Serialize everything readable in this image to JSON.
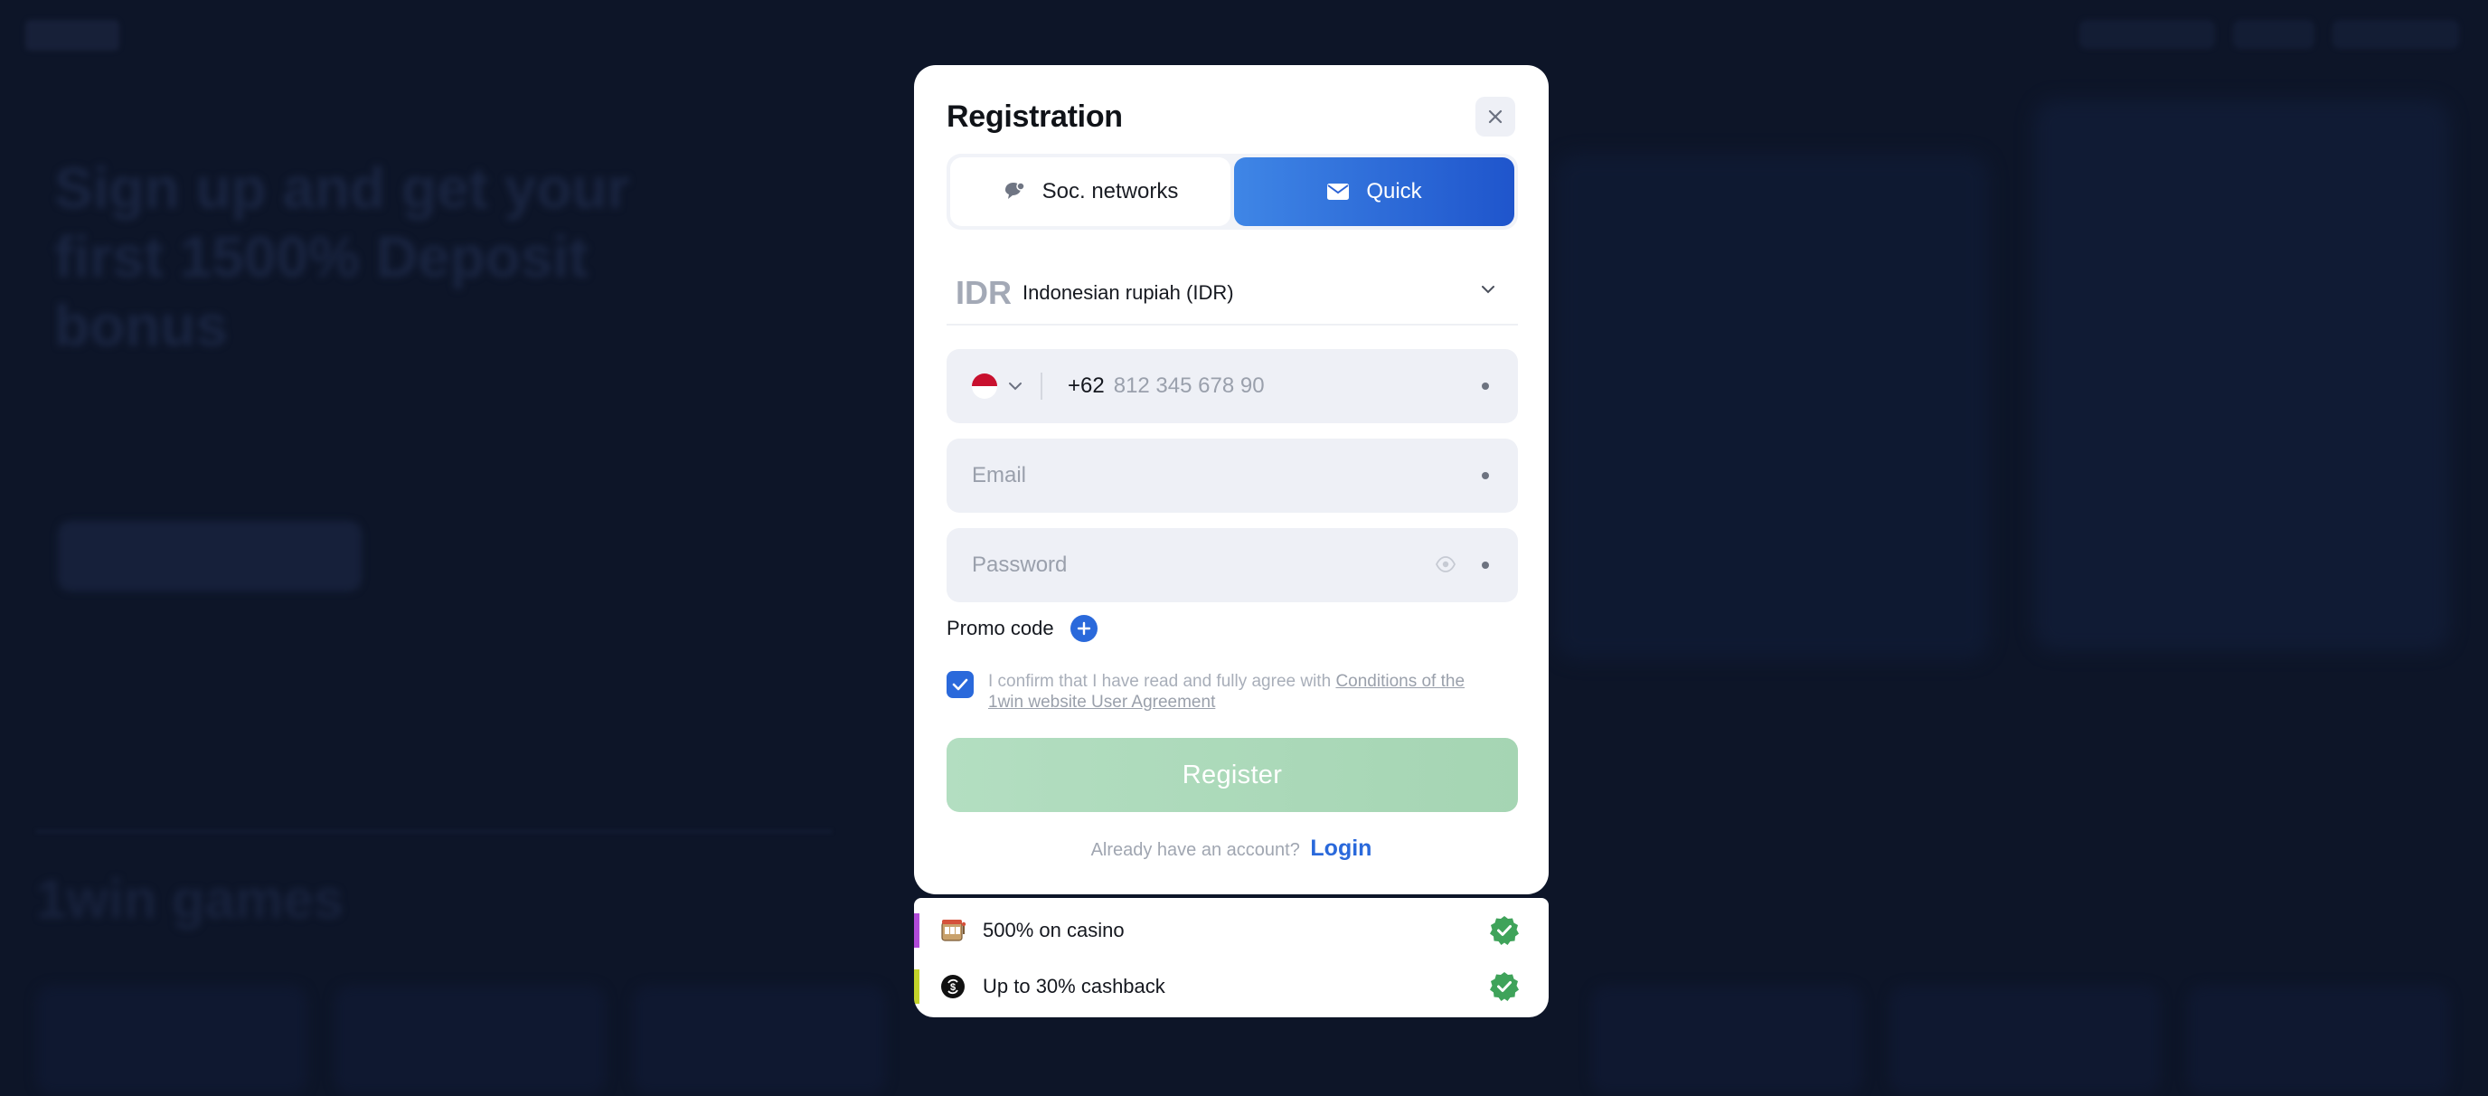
{
  "background": {
    "hero_text": "Sign up and get your first 1500% Deposit bonus",
    "games_heading": "1win games"
  },
  "modal": {
    "title": "Registration",
    "tabs": [
      {
        "label": "Soc. networks",
        "icon": "chat-bubble-icon",
        "active": false
      },
      {
        "label": "Quick",
        "icon": "envelope-icon",
        "active": true
      }
    ],
    "currency": {
      "code": "IDR",
      "name": "Indonesian rupiah (IDR)"
    },
    "phone": {
      "country_code": "+62",
      "placeholder": "812 345 678 90",
      "flag": "indonesia-flag"
    },
    "email": {
      "placeholder": "Email"
    },
    "password": {
      "placeholder": "Password"
    },
    "promo_code_label": "Promo code",
    "agreement": {
      "checked": true,
      "text": "I confirm that I have read and fully agree with ",
      "link_text": "Conditions of the 1win website User Agreement"
    },
    "register_label": "Register",
    "login_prompt": "Already have an account?",
    "login_label": "Login"
  },
  "bonuses": [
    {
      "label": "500% on casino",
      "icon": "slot-machine-icon",
      "accent": "#b04ad8"
    },
    {
      "label": "Up to 30% cashback",
      "icon": "cashback-icon",
      "accent": "#c3d42a"
    }
  ],
  "colors": {
    "brand_blue": "#2a69db",
    "register_green": "#a9d8b6",
    "check_green": "#3fa35a",
    "overlay_bg": "#0d1528"
  }
}
